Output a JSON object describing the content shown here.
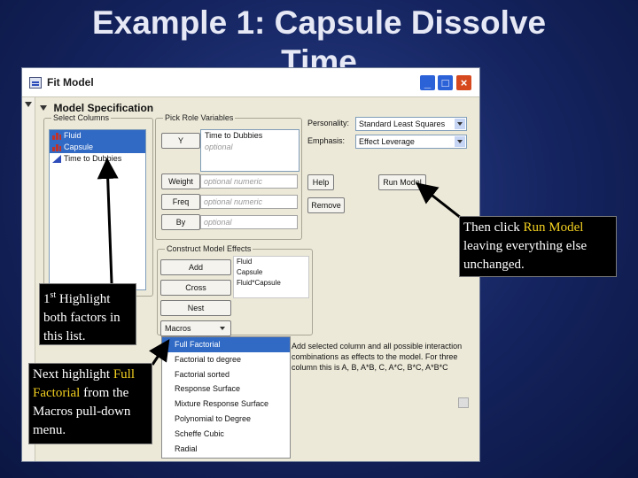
{
  "slide": {
    "title_line1": "Example 1: Capsule Dissolve",
    "title_line2": "Time"
  },
  "window": {
    "title": "Fit Model",
    "buttons": [
      "minimize",
      "maximize",
      "close"
    ]
  },
  "spec": {
    "header": "Model Specification",
    "select_columns": {
      "label": "Select Columns",
      "items": [
        {
          "label": "Fluid",
          "selected": true
        },
        {
          "label": "Capsule",
          "selected": true
        },
        {
          "label": "Time to Dubbies",
          "selected": false
        }
      ]
    },
    "pick_role": {
      "label": "Pick Role Variables",
      "y_button": "Y",
      "y_values": [
        "Time to Dubbies",
        "optional"
      ],
      "weight_button": "Weight",
      "weight_placeholder": "optional numeric",
      "freq_button": "Freq",
      "freq_placeholder": "optional numeric",
      "by_button": "By",
      "by_placeholder": "optional"
    },
    "personality": {
      "label": "Personality:",
      "value": "Standard Least Squares"
    },
    "emphasis": {
      "label": "Emphasis:",
      "value": "Effect Leverage"
    },
    "help_button": "Help",
    "run_button": "Run Model",
    "remove_button": "Remove",
    "construct": {
      "label": "Construct Model Effects",
      "add_button": "Add",
      "cross_button": "Cross",
      "nest_button": "Nest",
      "macros_button": "Macros",
      "effects": [
        "Fluid",
        "Capsule",
        "Fluid*Capsule"
      ]
    }
  },
  "macros_menu": [
    {
      "label": "Full Factorial",
      "selected": true
    },
    {
      "label": "Factorial to degree",
      "selected": false
    },
    {
      "label": "Factorial sorted",
      "selected": false
    },
    {
      "label": "Response Surface",
      "selected": false
    },
    {
      "label": "Mixture Response Surface",
      "selected": false
    },
    {
      "label": "Polynomial to Degree",
      "selected": false
    },
    {
      "label": "Scheffe Cubic",
      "selected": false
    },
    {
      "label": "Radial",
      "selected": false
    }
  ],
  "macro_description": "Add selected column and all possible interaction combinations as effects to the model. For three column this is A, B, A*B, C, A*C, B*C, A*B*C",
  "callouts": {
    "run": {
      "pre": "Then click ",
      "hl": "Run Model",
      "post": " leaving everything else unchanged."
    },
    "highlight": {
      "sup": "st",
      "num": "1",
      "text": " Highlight both factors in this list."
    },
    "next": {
      "pre": "Next highlight ",
      "hl": "Full Factorial",
      "post": " from the Macros pull-down menu."
    }
  },
  "colors": {
    "accent_highlight": "#f3d020",
    "selection": "#316ac5"
  }
}
